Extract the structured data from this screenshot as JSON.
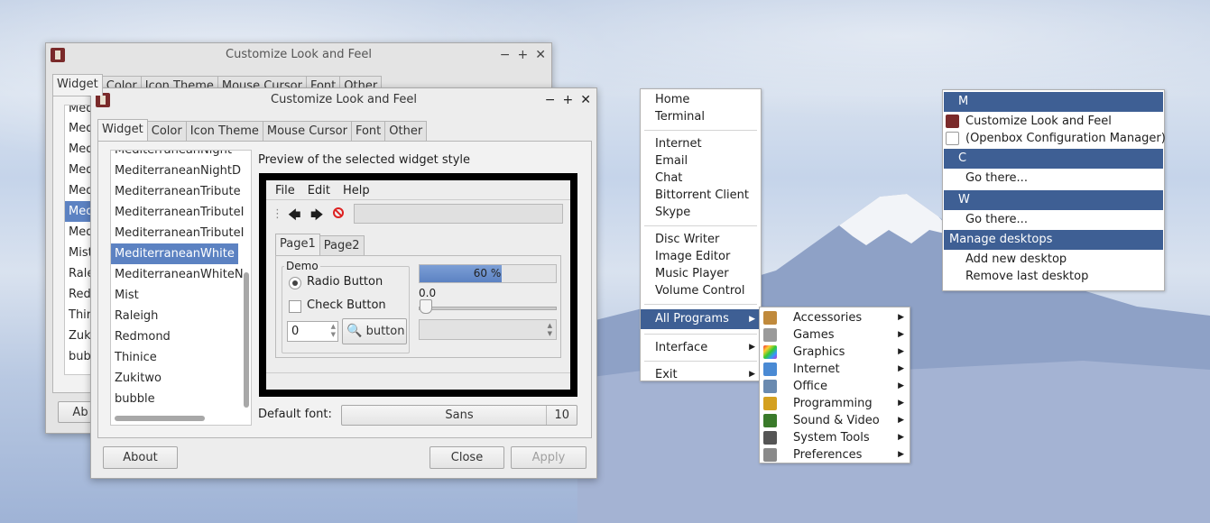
{
  "back_window": {
    "title": "Customize Look and Feel",
    "tabs": [
      "Widget",
      "Color",
      "Icon Theme",
      "Mouse Cursor",
      "Font",
      "Other"
    ],
    "list": [
      "Med",
      "Med",
      "Med",
      "Med",
      "Med",
      "Med",
      "Med",
      "Mist",
      "Rale",
      "Red",
      "Thir",
      "Zuk",
      "bub"
    ],
    "about": "Ab"
  },
  "front_window": {
    "title": "Customize Look and Feel",
    "tabs": [
      "Widget",
      "Color",
      "Icon Theme",
      "Mouse Cursor",
      "Font",
      "Other"
    ],
    "themes": [
      "MediterraneanNight",
      "MediterraneanNightD",
      "MediterraneanTribute",
      "MediterraneanTributeI",
      "MediterraneanTributeI",
      "MediterraneanWhite",
      "MediterraneanWhiteN",
      "Mist",
      "Raleigh",
      "Redmond",
      "Thinice",
      "Zukitwo",
      "bubble"
    ],
    "selected_theme": "MediterraneanWhite",
    "preview_label": "Preview of the selected widget style",
    "preview": {
      "menus": [
        "File",
        "Edit",
        "Help"
      ],
      "tabs": [
        "Page1",
        "Page2"
      ],
      "group": "Demo",
      "radio": "Radio Button",
      "check": "Check Button",
      "spin_value": "0",
      "button": "button",
      "progress_text": "60 %",
      "progress": 0.6,
      "scale_value": "0.0"
    },
    "font_label": "Default font:",
    "font_name": "Sans",
    "font_size": "10",
    "about": "About",
    "close": "Close",
    "apply": "Apply"
  },
  "app_menu": {
    "groups": [
      [
        "Home",
        "Terminal"
      ],
      [
        "Internet",
        "Email",
        "Chat",
        "Bittorrent Client",
        "Skype"
      ],
      [
        "Disc Writer",
        "Image Editor",
        "Music Player",
        "Volume Control"
      ]
    ],
    "all_programs": "All Programs",
    "interface": "Interface",
    "exit": "Exit"
  },
  "programs_submenu": {
    "items": [
      {
        "label": "Accessories",
        "icon": "accessories-icon",
        "color": "#c08a3c"
      },
      {
        "label": "Games",
        "icon": "games-icon",
        "color": "#9a9a9a"
      },
      {
        "label": "Graphics",
        "icon": "graphics-icon",
        "color": "#d44a8a"
      },
      {
        "label": "Internet",
        "icon": "internet-icon",
        "color": "#4a8ad4"
      },
      {
        "label": "Office",
        "icon": "office-icon",
        "color": "#6a8ab0"
      },
      {
        "label": "Programming",
        "icon": "programming-icon",
        "color": "#d4a020"
      },
      {
        "label": "Sound & Video",
        "icon": "sound-video-icon",
        "color": "#3a7a2a"
      },
      {
        "label": "System Tools",
        "icon": "system-tools-icon",
        "color": "#555555"
      },
      {
        "label": "Preferences",
        "icon": "preferences-icon",
        "color": "#8a8a8a"
      }
    ]
  },
  "desktop_menu": {
    "m_header": "M",
    "m_items": [
      "Customize Look and Feel",
      "(Openbox Configuration Manager)"
    ],
    "c_header": "C",
    "c_item": "Go there...",
    "w_header": "W",
    "w_item": "Go there...",
    "manage_header": "Manage desktops",
    "manage_items": [
      "Add new desktop",
      "Remove last desktop"
    ]
  },
  "colors": {
    "accent": "#3e5f94",
    "selection": "#5c82c2"
  }
}
